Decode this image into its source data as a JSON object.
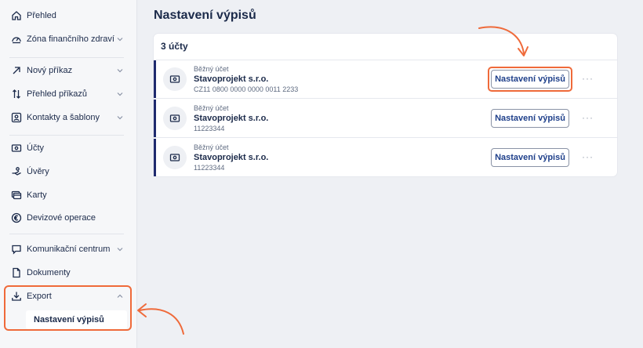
{
  "sidebar": {
    "items": [
      {
        "label": "Přehled",
        "icon": "home-icon",
        "chevron": false
      },
      {
        "label": "Zóna finančního zdraví",
        "icon": "gauge-icon",
        "chevron": true
      },
      {
        "label": "Nový příkaz",
        "icon": "arrow-up-right-icon",
        "chevron": true
      },
      {
        "label": "Přehled příkazů",
        "icon": "transfer-arrows-icon",
        "chevron": true
      },
      {
        "label": "Kontakty a šablony",
        "icon": "contact-card-icon",
        "chevron": true
      },
      {
        "label": "Účty",
        "icon": "account-icon",
        "chevron": false
      },
      {
        "label": "Úvěry",
        "icon": "loan-icon",
        "chevron": false
      },
      {
        "label": "Karty",
        "icon": "cards-icon",
        "chevron": false
      },
      {
        "label": "Devizové operace",
        "icon": "currency-icon",
        "chevron": false
      },
      {
        "label": "Komunikační centrum",
        "icon": "chat-icon",
        "chevron": true
      },
      {
        "label": "Dokumenty",
        "icon": "document-icon",
        "chevron": false
      },
      {
        "label": "Export",
        "icon": "download-icon",
        "chevron": true
      }
    ],
    "submenu": {
      "label": "Nastavení výpisů"
    }
  },
  "main": {
    "title": "Nastavení výpisů",
    "card_header": "3 účty",
    "accounts": [
      {
        "type": "Běžný účet",
        "name": "Stavoprojekt s.r.o.",
        "number": "CZ11 0800 0000 0000 0011 2233",
        "button": "Nastavení výpisů",
        "more": "···"
      },
      {
        "type": "Běžný účet",
        "name": "Stavoprojekt s.r.o.",
        "number": "11223344",
        "button": "Nastavení výpisů",
        "more": "···"
      },
      {
        "type": "Běžný účet",
        "name": "Stavoprojekt s.r.o.",
        "number": "11223344",
        "button": "Nastavení výpisů",
        "more": "···"
      }
    ]
  },
  "colors": {
    "accent": "#ef6a3a",
    "navy": "#1e2a6e",
    "text": "#1b2a4a",
    "link": "#1e3f8a"
  }
}
